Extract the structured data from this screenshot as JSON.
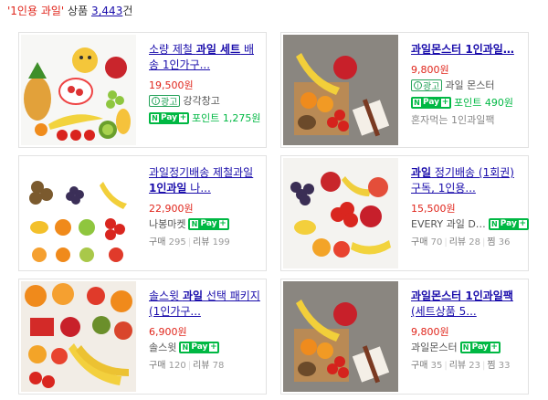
{
  "header": {
    "query": "'1인용 과일'",
    "label": "상품",
    "count": "3,443",
    "suffix": "건"
  },
  "ad_label": "광고",
  "ad_info": "i",
  "npay": {
    "n": "N",
    "text": "Pay",
    "plus": "+"
  },
  "products": [
    {
      "title_pre": "소량 제철 ",
      "title_bold": "과일 세트",
      "title_post": " 배송 1인가구...",
      "price": "19,500원",
      "ad": true,
      "seller": "강각창고",
      "npay": true,
      "point": "포인트 1,275원",
      "note": ""
    },
    {
      "title_pre": "",
      "title_bold": "과일몬스터 1인과일…",
      "title_post": "",
      "price": "9,800원",
      "ad": true,
      "seller": "과일 몬스터",
      "npay": true,
      "point": "포인트 490원",
      "note": "혼자먹는 1인과일팩"
    },
    {
      "title_pre": "과일정기배송 제철과일 ",
      "title_bold": "1인과일",
      "title_post": " 나...",
      "price": "22,900원",
      "ad": false,
      "seller": "나봉마켓",
      "npay": true,
      "point": "",
      "stats": {
        "buy": "구매",
        "buy_n": "295",
        "review": "리뷰",
        "review_n": "199"
      }
    },
    {
      "title_pre": "",
      "title_bold": "과일",
      "title_post": " 정기배송 (1회권) 구독, 1인용...",
      "price": "15,500원",
      "ad": false,
      "seller": "EVERY 과일 D…",
      "npay": true,
      "point": "",
      "stats": {
        "buy": "구매",
        "buy_n": "70",
        "review": "리뷰",
        "review_n": "28",
        "zzim": "찜",
        "zzim_n": "36"
      }
    },
    {
      "title_pre": "솔스윗 ",
      "title_bold": "과일",
      "title_post": " 선택 패키지 (1인가구...",
      "price": "6,900원",
      "ad": false,
      "seller": "솔스윗",
      "npay": true,
      "point": "",
      "stats": {
        "buy": "구매",
        "buy_n": "120",
        "review": "리뷰",
        "review_n": "78"
      }
    },
    {
      "title_pre": "",
      "title_bold": "과일몬스터 1인과일팩",
      "title_post": " (세트상품 5...",
      "price": "9,800원",
      "ad": false,
      "seller": "과일몬스터",
      "npay": true,
      "point": "",
      "stats": {
        "buy": "구매",
        "buy_n": "35",
        "review": "리뷰",
        "review_n": "23",
        "zzim": "찜",
        "zzim_n": "33"
      }
    }
  ]
}
